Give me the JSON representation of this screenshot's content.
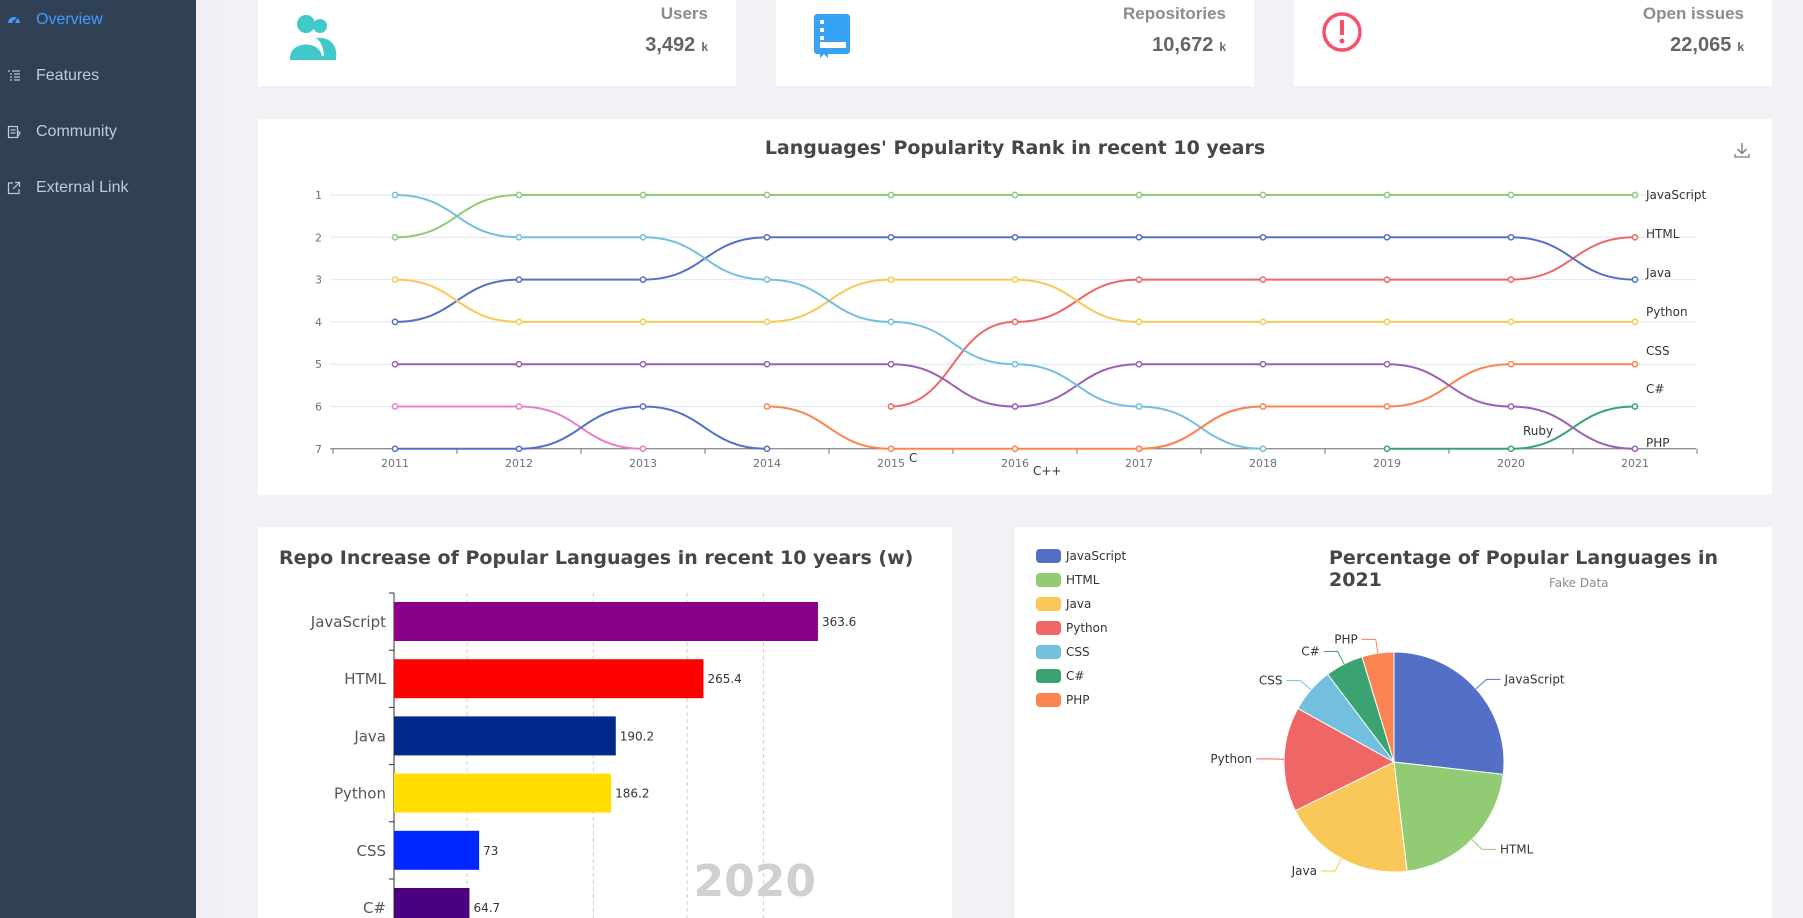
{
  "sidebar": {
    "items": [
      {
        "label": "Overview",
        "icon": "dashboard-icon",
        "active": true
      },
      {
        "label": "Features",
        "icon": "list-icon",
        "active": false
      },
      {
        "label": "Community",
        "icon": "document-icon",
        "active": false
      },
      {
        "label": "External Link",
        "icon": "external-link-icon",
        "active": false
      }
    ]
  },
  "stats": [
    {
      "title": "Users",
      "value": "3,492",
      "unit": "k",
      "icon": "users-icon",
      "color": "#40c9c6"
    },
    {
      "title": "Repositories",
      "value": "10,672",
      "unit": "k",
      "icon": "repository-icon",
      "color": "#36a3f7"
    },
    {
      "title": "Open issues",
      "value": "22,065",
      "unit": "k",
      "icon": "issue-icon",
      "color": "#f4516c"
    }
  ],
  "chart_data": [
    {
      "type": "line",
      "title": "Languages' Popularity Rank in recent 10 years",
      "x": [
        "2011",
        "2012",
        "2013",
        "2014",
        "2015",
        "2016",
        "2017",
        "2018",
        "2019",
        "2020",
        "2021"
      ],
      "ylim": [
        1,
        7
      ],
      "y_ticks": [
        "1",
        "2",
        "3",
        "4",
        "5",
        "6",
        "7"
      ],
      "y_inverted": true,
      "smooth": true,
      "series": [
        {
          "name": "JavaScript",
          "color": "#91cc75",
          "values": [
            2,
            1,
            1,
            1,
            1,
            1,
            1,
            1,
            1,
            1,
            1
          ]
        },
        {
          "name": "HTML",
          "color": "#ee6666",
          "values": [
            null,
            null,
            null,
            null,
            6,
            4,
            3,
            3,
            3,
            3,
            2
          ]
        },
        {
          "name": "Java",
          "color": "#5470c6",
          "values": [
            4,
            3,
            3,
            2,
            2,
            2,
            2,
            2,
            2,
            2,
            3
          ]
        },
        {
          "name": "Python",
          "color": "#fac858",
          "values": [
            3,
            4,
            4,
            4,
            3,
            3,
            4,
            4,
            4,
            4,
            4
          ]
        },
        {
          "name": "CSS",
          "color": "#fc8452",
          "values": [
            null,
            null,
            null,
            null,
            null,
            null,
            7,
            6,
            6,
            5,
            5
          ]
        },
        {
          "name": "C#",
          "color": "#3ba272",
          "values": [
            null,
            null,
            null,
            null,
            null,
            null,
            null,
            null,
            7,
            7,
            6
          ]
        },
        {
          "name": "PHP",
          "color": "#9a60b4",
          "values": [
            5,
            5,
            5,
            5,
            5,
            6,
            5,
            5,
            5,
            6,
            7
          ]
        },
        {
          "name": "Ruby",
          "color": "#73c0de",
          "values": [
            1,
            2,
            2,
            3,
            4,
            5,
            6,
            7,
            null,
            null,
            null
          ]
        },
        {
          "name": "C",
          "color": "#ea7ccc",
          "values": [
            6,
            6,
            7,
            null,
            null,
            null,
            null,
            null,
            null,
            null,
            null
          ]
        },
        {
          "name": "C++",
          "color": "#5470c6",
          "values": [
            7,
            7,
            6,
            7,
            null,
            null,
            null,
            null,
            null,
            null,
            null
          ]
        },
        {
          "name": "",
          "color": "#fc8452",
          "values": [
            null,
            null,
            null,
            6,
            7,
            7,
            7,
            6,
            null,
            null,
            null
          ]
        }
      ]
    },
    {
      "type": "bar",
      "title": "Repo Increase of Popular Languages in recent 10 years (w)",
      "orientation": "horizontal",
      "categories": [
        "JavaScript",
        "HTML",
        "Java",
        "Python",
        "CSS",
        "C#"
      ],
      "values": [
        363.6,
        265.4,
        190.2,
        186.2,
        73,
        64.7
      ],
      "colors": [
        "#8b008b",
        "#ff0000",
        "#00298b",
        "#ffde00",
        "#0026ff",
        "#4b0082"
      ],
      "watermark": "2020"
    },
    {
      "type": "pie",
      "title": "Percentage of Popular Languages in 2021",
      "subtitle": "Fake Data",
      "slices": [
        {
          "name": "JavaScript",
          "value": 26.8,
          "color": "#5470c6"
        },
        {
          "name": "HTML",
          "value": 21.3,
          "color": "#91cc75"
        },
        {
          "name": "Java",
          "value": 19.6,
          "color": "#fac858"
        },
        {
          "name": "Python",
          "value": 15.4,
          "color": "#ee6666"
        },
        {
          "name": "CSS",
          "value": 6.6,
          "color": "#73c0de"
        },
        {
          "name": "C#",
          "value": 5.6,
          "color": "#3ba272"
        },
        {
          "name": "PHP",
          "value": 4.7,
          "color": "#fc8452"
        }
      ],
      "legend_position": "left"
    }
  ]
}
